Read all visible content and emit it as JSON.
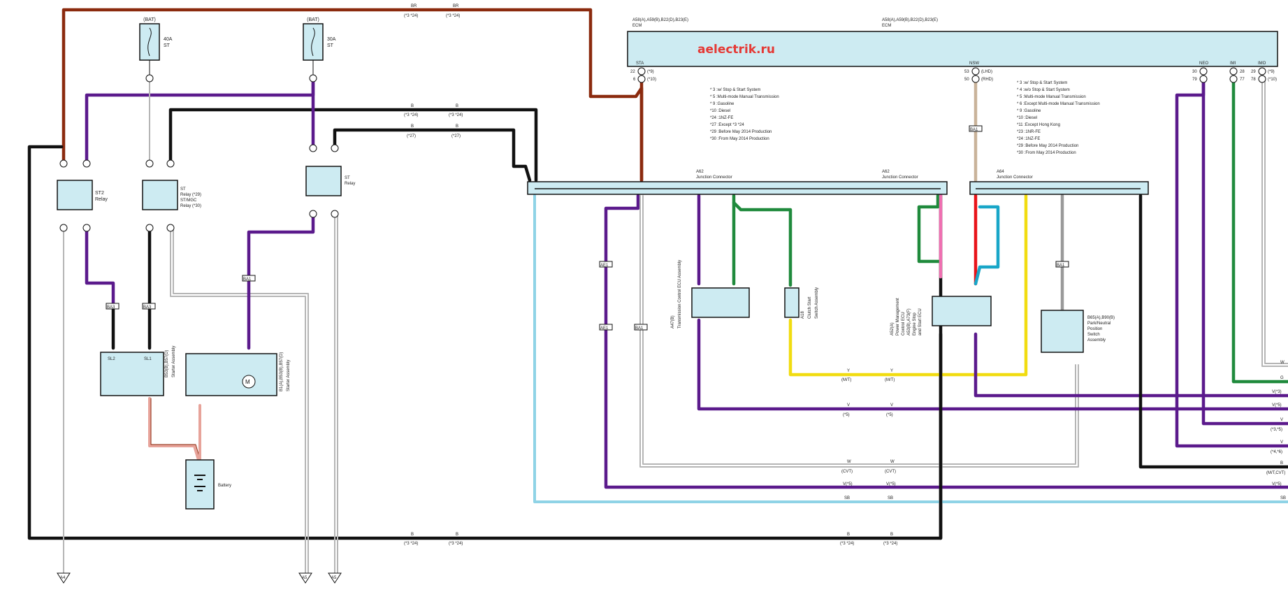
{
  "colors": {
    "BR": "#8b2a0e",
    "V": "#5b1a8c",
    "B": "#111111",
    "W": "#b5b5b5",
    "G": "#1f8a3c",
    "Y": "#f1dc10",
    "SB": "#8fd3e6",
    "P": "#ef6fb1",
    "R": "#e8141a",
    "L": "#18a6c8",
    "GR": "#9a9a9a",
    "BE": "#c9b39a",
    "BR_pink": "#e7a39a",
    "box_fill": "#cdebf2"
  },
  "watermark": "aelectrik.ru",
  "ecm": {
    "title_left": "A58(A),A59(B),B22(D),B23(E)",
    "title_right": "A58(A),A59(B),B22(D),B23(E)",
    "name": "ECM",
    "pins": [
      "STA",
      "NSW",
      "NEO",
      "IMI",
      "IMO"
    ],
    "sta_rows": [
      "22",
      "(*9)",
      "6",
      "(*10)"
    ],
    "nsw_rows": [
      "53",
      "(LHD)",
      "50",
      "(RHD)"
    ],
    "right_rows": [
      "30",
      "28",
      "29",
      "(*9)",
      "79",
      "77",
      "78",
      "(*10)"
    ]
  },
  "notes_left": [
    "*  3 :w/ Stop & Start System",
    "*  5 :Multi-mode Manual Transmission",
    "*  9 :Gasoline",
    "*10 :Diesel",
    "*24 :1NZ-FE",
    "*27 :Except *3 *24",
    "*29 :Before May 2014 Production",
    "*30 :From May 2014 Production"
  ],
  "notes_right": [
    "*  3 :w/ Stop & Start System",
    "*  4 :w/o Stop & Start System",
    "*  5 :Multi-mode Manual Transmission",
    "*  6 :Except Multi-mode Manual Transmission",
    "*  9 :Gasoline",
    "*10 :Diesel",
    "*11 :Except Hong Kong",
    "*23 :1NR-FE",
    "*24 :1NZ-FE",
    "*29 :Before May 2014 Production",
    "*30 :From May 2014 Production"
  ],
  "fuses": [
    {
      "bat": "(BAT)",
      "rating": "40A",
      "name": "ST"
    },
    {
      "bat": "(BAT)",
      "rating": "30A",
      "name": "ST"
    }
  ],
  "relays": {
    "st2": "ST2\nRelay",
    "st_l1": "ST",
    "st_l2": "Relay (*29)",
    "st_l3": "ST/MGC",
    "st_l4": "Relay (*30)",
    "st_right_l1": "ST",
    "st_right_l2": "Relay"
  },
  "junctions": {
    "a62_left_l1": "A62",
    "a62_left_l2": "Junction Connector",
    "a62_right_l1": "A62",
    "a62_right_l2": "Junction Connector",
    "a64_l1": "A64",
    "a64_l2": "Junction Connector"
  },
  "components": {
    "starter_b": [
      "B53(B),B57(D)",
      "Starter Assembly"
    ],
    "starter_a": [
      "B1(A),B53(B),B57(D)",
      "Starter Assembly"
    ],
    "battery": "Battery",
    "tc_ecu": [
      "A47(B)",
      "Transmission Control ECU Assembly"
    ],
    "clutch": [
      "A18",
      "Clutch Start",
      "Switch Assembly"
    ],
    "pm_ecu": [
      "A52(A)",
      "Power Management",
      "Control ECU",
      "A53(B),A73(F)",
      "Engine Stop",
      "and Start ECU"
    ],
    "pnp_l1": "B65(A),B90(B)",
    "pnp_l2": "Park/Neutral",
    "pnp_l3": "Position",
    "pnp_l4": "Switch",
    "pnp_l5": "Assembly"
  },
  "grounds": [
    "A4",
    "A5",
    "A5"
  ],
  "connectors": [
    "BA3",
    "BA3",
    "BA1",
    "AE1",
    "AE1",
    "BA1",
    "BA1",
    "BA1"
  ],
  "wire_labels": {
    "top_br": [
      "BR",
      "(*3 *24)",
      "BR",
      "(*3 *24)"
    ],
    "b_top": [
      "B",
      "(*3 *24)",
      "B",
      "(*3 *24)"
    ],
    "b_27": [
      "B",
      "(*27)",
      "B",
      "(*27)"
    ],
    "y_mt": [
      "Y",
      "(M/T)",
      "Y",
      "(M/T)"
    ],
    "v_5": [
      "V",
      "(*5)",
      "V",
      "(*5)"
    ],
    "w_cvt": [
      "W",
      "(CVT)",
      "W",
      "(CVT)"
    ],
    "v5_low": [
      "V(*5)",
      "V(*5)"
    ],
    "sb": [
      "SB",
      "SB"
    ],
    "b_bottom": [
      "B",
      "(*3 *24)",
      "B",
      "(*3 *24)",
      "B",
      "(*3 *24)",
      "B",
      "(*3 *24)"
    ]
  },
  "right_edge_labels": [
    "W",
    "G",
    "V(*3)",
    "V(*5)",
    "V",
    "(*3,*5)",
    "V",
    "(*4,*6)",
    "B",
    "(M/T,CVT)",
    "V(*5)",
    "SB"
  ]
}
